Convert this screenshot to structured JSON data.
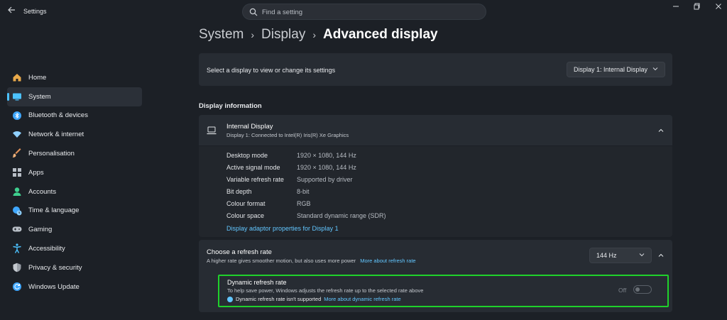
{
  "window": {
    "app_title": "Settings",
    "back_icon": "back-arrow-icon",
    "controls": [
      "minimize-icon",
      "maximize-icon",
      "close-icon"
    ]
  },
  "search": {
    "placeholder": "Find a setting",
    "value": ""
  },
  "sidebar": {
    "items": [
      {
        "label": "Home",
        "icon": "home-icon",
        "color": "#e8a94a"
      },
      {
        "label": "System",
        "icon": "system-icon",
        "color": "#4cc2ff",
        "active": true
      },
      {
        "label": "Bluetooth & devices",
        "icon": "bluetooth-icon",
        "color": "#3fa7ff"
      },
      {
        "label": "Network & internet",
        "icon": "wifi-icon",
        "color": "#8fd0ff"
      },
      {
        "label": "Personalisation",
        "icon": "brush-icon",
        "color": "#e0925a"
      },
      {
        "label": "Apps",
        "icon": "apps-icon",
        "color": "#b8bec6"
      },
      {
        "label": "Accounts",
        "icon": "accounts-icon",
        "color": "#3ecf8e"
      },
      {
        "label": "Time & language",
        "icon": "globe-clock-icon",
        "color": "#3fa7ff"
      },
      {
        "label": "Gaming",
        "icon": "gamepad-icon",
        "color": "#b8bec6"
      },
      {
        "label": "Accessibility",
        "icon": "accessibility-icon",
        "color": "#4cc2ff"
      },
      {
        "label": "Privacy & security",
        "icon": "shield-icon",
        "color": "#9aa0a8"
      },
      {
        "label": "Windows Update",
        "icon": "update-icon",
        "color": "#3fa7ff"
      }
    ]
  },
  "breadcrumb": {
    "items": [
      "System",
      "Display",
      "Advanced display"
    ]
  },
  "select_display": {
    "label": "Select a display to view or change its settings",
    "dropdown_value": "Display 1: Internal Display"
  },
  "display_info": {
    "section_title": "Display information",
    "title": "Internal Display",
    "subtitle": "Display 1: Connected to Intel(R) Iris(R) Xe Graphics",
    "rows": [
      {
        "key": "Desktop mode",
        "value": "1920 × 1080, 144 Hz"
      },
      {
        "key": "Active signal mode",
        "value": "1920 × 1080, 144 Hz"
      },
      {
        "key": "Variable refresh rate",
        "value": "Supported by driver"
      },
      {
        "key": "Bit depth",
        "value": "8-bit"
      },
      {
        "key": "Colour format",
        "value": "RGB"
      },
      {
        "key": "Colour space",
        "value": "Standard dynamic range (SDR)"
      }
    ],
    "adaptor_link": "Display adaptor properties for Display 1"
  },
  "refresh_rate": {
    "title": "Choose a refresh rate",
    "subtitle": "A higher rate gives smoother motion, but also uses more power",
    "more_link": "More about refresh rate",
    "dropdown_value": "144 Hz",
    "dynamic": {
      "title": "Dynamic refresh rate",
      "subtitle": "To help save power, Windows adjusts the refresh rate up to the selected rate above",
      "note": "Dynamic refresh rate isn't supported",
      "note_link": "More about dynamic refresh rate",
      "toggle_label": "Off",
      "highlight_color": "#1fd12b"
    }
  },
  "colors": {
    "accent": "#4cc2ff",
    "link": "#62c6ff",
    "background": "#1c2026",
    "card": "#272c33"
  }
}
